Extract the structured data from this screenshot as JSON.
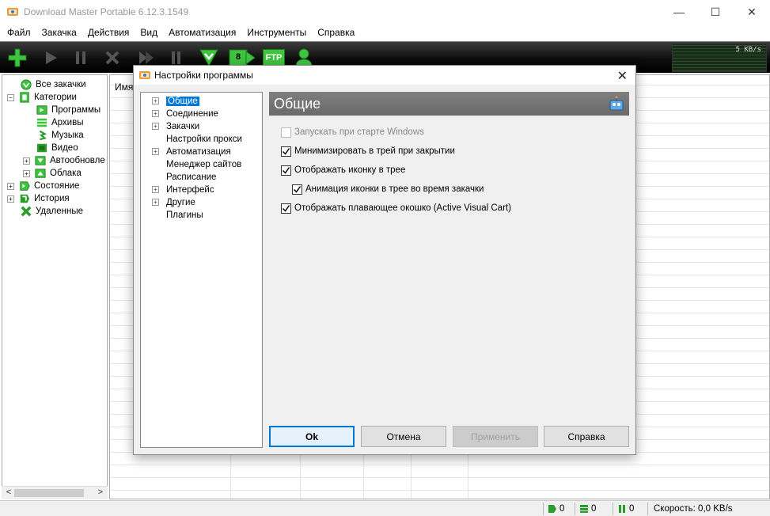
{
  "window": {
    "title": "Download Master Portable 6.12.3.1549",
    "minimize": "—",
    "maximize": "☐",
    "close": "✕"
  },
  "menu": [
    "Файл",
    "Закачка",
    "Действия",
    "Вид",
    "Автоматизация",
    "Инструменты",
    "Справка"
  ],
  "toolbar": {
    "queue_count": "8",
    "ftp_label": "FTP",
    "speed_label": "5 KB/s"
  },
  "left_tree": {
    "items": [
      {
        "label": "Все закачки",
        "icon": "all-downloads-icon"
      },
      {
        "label": "Категории",
        "icon": "categories-icon"
      },
      {
        "label": "Программы",
        "icon": "programs-icon"
      },
      {
        "label": "Архивы",
        "icon": "archives-icon"
      },
      {
        "label": "Музыка",
        "icon": "music-icon"
      },
      {
        "label": "Видео",
        "icon": "video-icon"
      },
      {
        "label": "Автообновле",
        "icon": "autoupdate-icon"
      },
      {
        "label": "Облака",
        "icon": "clouds-icon"
      },
      {
        "label": "Состояние",
        "icon": "status-icon"
      },
      {
        "label": "История",
        "icon": "history-icon"
      },
      {
        "label": "Удаленные",
        "icon": "deleted-icon"
      }
    ]
  },
  "list": {
    "column_name": "Имя"
  },
  "statusbar": {
    "active": "0",
    "queued": "0",
    "paused": "0",
    "speed": "Скорость: 0,0 KB/s"
  },
  "dialog": {
    "title": "Настройки программы",
    "close": "✕",
    "tree": [
      {
        "label": "Общие",
        "expandable": true,
        "selected": true
      },
      {
        "label": "Соединение",
        "expandable": true
      },
      {
        "label": "Закачки",
        "expandable": true
      },
      {
        "label": "Настройки прокси",
        "expandable": false
      },
      {
        "label": "Автоматизация",
        "expandable": true
      },
      {
        "label": "Менеджер сайтов",
        "expandable": false
      },
      {
        "label": "Расписание",
        "expandable": false
      },
      {
        "label": "Интерфейс",
        "expandable": true
      },
      {
        "label": "Другие",
        "expandable": true
      },
      {
        "label": "Плагины",
        "expandable": false
      }
    ],
    "section_title": "Общие",
    "options": [
      {
        "label": "Запускать при старте Windows",
        "checked": false,
        "disabled": true
      },
      {
        "label": "Минимизировать в трей при закрытии",
        "checked": true
      },
      {
        "label": "Отображать иконку в трее",
        "checked": true
      },
      {
        "label": "Анимация иконки в трее во время закачки",
        "checked": true
      },
      {
        "label": "Отображать плавающее окошко (Active Visual Cart)",
        "checked": true
      }
    ],
    "buttons": {
      "ok": "Ok",
      "cancel": "Отмена",
      "apply": "Применить",
      "help": "Справка"
    }
  },
  "colors": {
    "accent": "#0078d7",
    "brand_green": "#2fb52f",
    "section_header": "#737373"
  }
}
